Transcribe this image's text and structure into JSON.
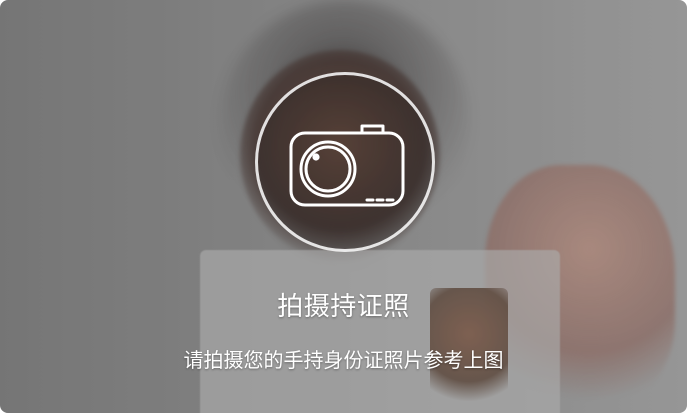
{
  "capture": {
    "title": "拍摄持证照",
    "instruction": "请拍摄您的手持身份证照片参考上图",
    "icon": "camera-icon"
  }
}
